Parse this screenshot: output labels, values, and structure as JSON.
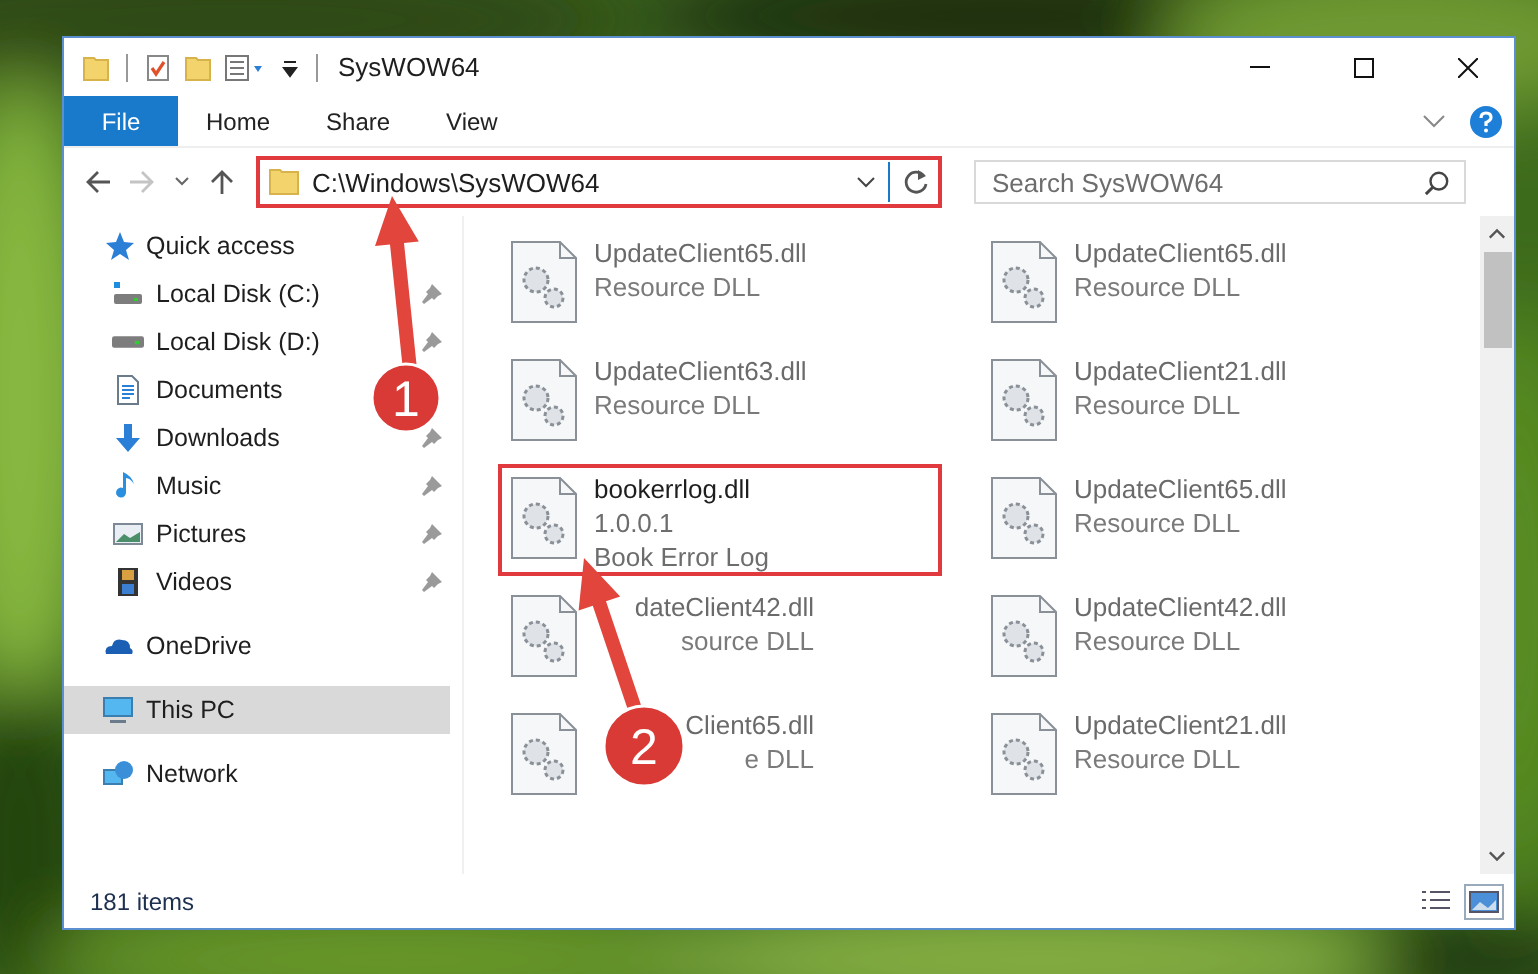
{
  "window": {
    "title": "SysWOW64"
  },
  "ribbon_tabs": [
    {
      "label": "File",
      "kind": "file-menu"
    },
    {
      "label": "Home",
      "kind": "tab"
    },
    {
      "label": "Share",
      "kind": "tab"
    },
    {
      "label": "View",
      "kind": "tab"
    }
  ],
  "address": {
    "path": "C:\\Windows\\SysWOW64",
    "highlighted": true
  },
  "search": {
    "placeholder": "Search SysWOW64"
  },
  "sidebar": {
    "items": [
      {
        "label": "Quick access",
        "kind": "star",
        "selected": false,
        "children": [
          {
            "label": "Local Disk (C:)",
            "kind": "drive-c",
            "pinned": true,
            "selected": false
          },
          {
            "label": "Local Disk (D:)",
            "kind": "drive",
            "pinned": true,
            "selected": false
          },
          {
            "label": "Documents",
            "kind": "documents",
            "pinned": false,
            "selected": false
          },
          {
            "label": "Downloads",
            "kind": "downloads",
            "pinned": true,
            "selected": false
          },
          {
            "label": "Music",
            "kind": "music",
            "pinned": true,
            "selected": false
          },
          {
            "label": "Pictures",
            "kind": "pictures",
            "pinned": true,
            "selected": false
          },
          {
            "label": "Videos",
            "kind": "videos",
            "pinned": true,
            "selected": false
          }
        ]
      },
      {
        "label": "OneDrive",
        "kind": "cloud",
        "selected": false
      },
      {
        "label": "This PC",
        "kind": "pc",
        "selected": true
      },
      {
        "label": "Network",
        "kind": "network",
        "selected": false
      }
    ]
  },
  "files": [
    {
      "name": "UpdateClient65.dll",
      "line_2": "Resource DLL",
      "highlighted": false,
      "covered": false
    },
    {
      "name": "UpdateClient65.dll",
      "line_2": "Resource DLL",
      "highlighted": false,
      "covered": false
    },
    {
      "name": "UpdateClient63.dll",
      "line_2": "Resource DLL",
      "highlighted": false,
      "covered": false
    },
    {
      "name": "UpdateClient21.dll",
      "line_2": "Resource DLL",
      "highlighted": false,
      "covered": false
    },
    {
      "name": "bookerrlog.dll",
      "line_2": "1.0.0.1",
      "line_3": "Book Error Log",
      "highlighted": true,
      "covered": false
    },
    {
      "name": "UpdateClient65.dll",
      "line_2": "Resource DLL",
      "highlighted": false,
      "covered": false
    },
    {
      "name": "dateClient42.dll",
      "line_2": "source DLL",
      "highlighted": false,
      "covered": true
    },
    {
      "name": "UpdateClient42.dll",
      "line_2": "Resource DLL",
      "highlighted": false,
      "covered": false
    },
    {
      "name": "Client65.dll",
      "line_2": "e DLL",
      "highlighted": false,
      "covered": true
    },
    {
      "name": "UpdateClient21.dll",
      "line_2": "Resource DLL",
      "highlighted": false,
      "covered": false
    }
  ],
  "status_bar": {
    "count": "181 items"
  },
  "view_buttons": [
    {
      "kind": "details",
      "selected": false
    },
    {
      "kind": "large-icons",
      "selected": true
    }
  ],
  "annotations": [
    {
      "number": "1"
    },
    {
      "number": "2"
    }
  ]
}
